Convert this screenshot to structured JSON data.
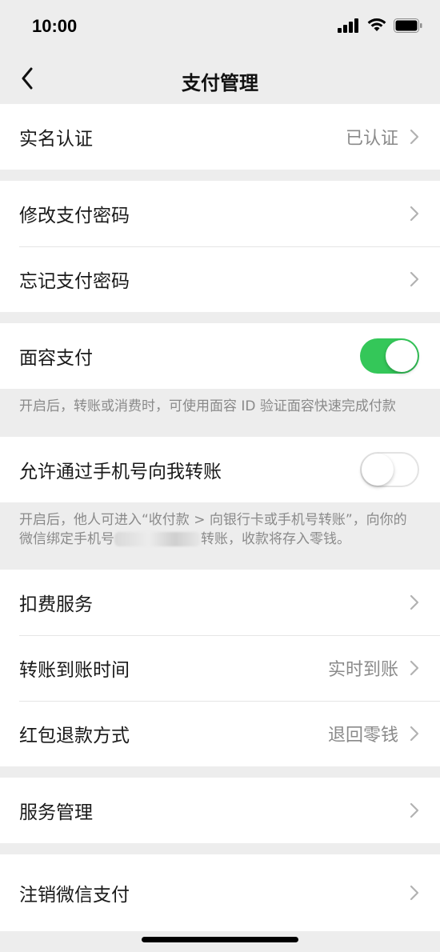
{
  "status_bar": {
    "time": "10:00"
  },
  "nav": {
    "title": "支付管理"
  },
  "rows": {
    "real_name": {
      "label": "实名认证",
      "value": "已认证"
    },
    "change_password": {
      "label": "修改支付密码"
    },
    "forgot_password": {
      "label": "忘记支付密码"
    },
    "face_pay": {
      "label": "面容支付",
      "enabled": true,
      "hint": "开启后，转账或消费时，可使用面容 ID 验证面容快速完成付款"
    },
    "phone_transfer": {
      "label": "允许通过手机号向我转账",
      "enabled": false,
      "hint_before": "开启后，他人可进入“收付款 > 向银行卡或手机号转账”，向你的微信绑定手机号",
      "hint_after": "转账，收款将存入零钱。"
    },
    "deduction_service": {
      "label": "扣费服务"
    },
    "transfer_time": {
      "label": "转账到账时间",
      "value": "实时到账"
    },
    "redpacket_refund": {
      "label": "红包退款方式",
      "value": "退回零钱"
    },
    "service_management": {
      "label": "服务管理"
    },
    "close_wechat_pay": {
      "label": "注销微信支付"
    }
  },
  "colors": {
    "toggle_on": "#34c759",
    "background": "#ededed"
  }
}
